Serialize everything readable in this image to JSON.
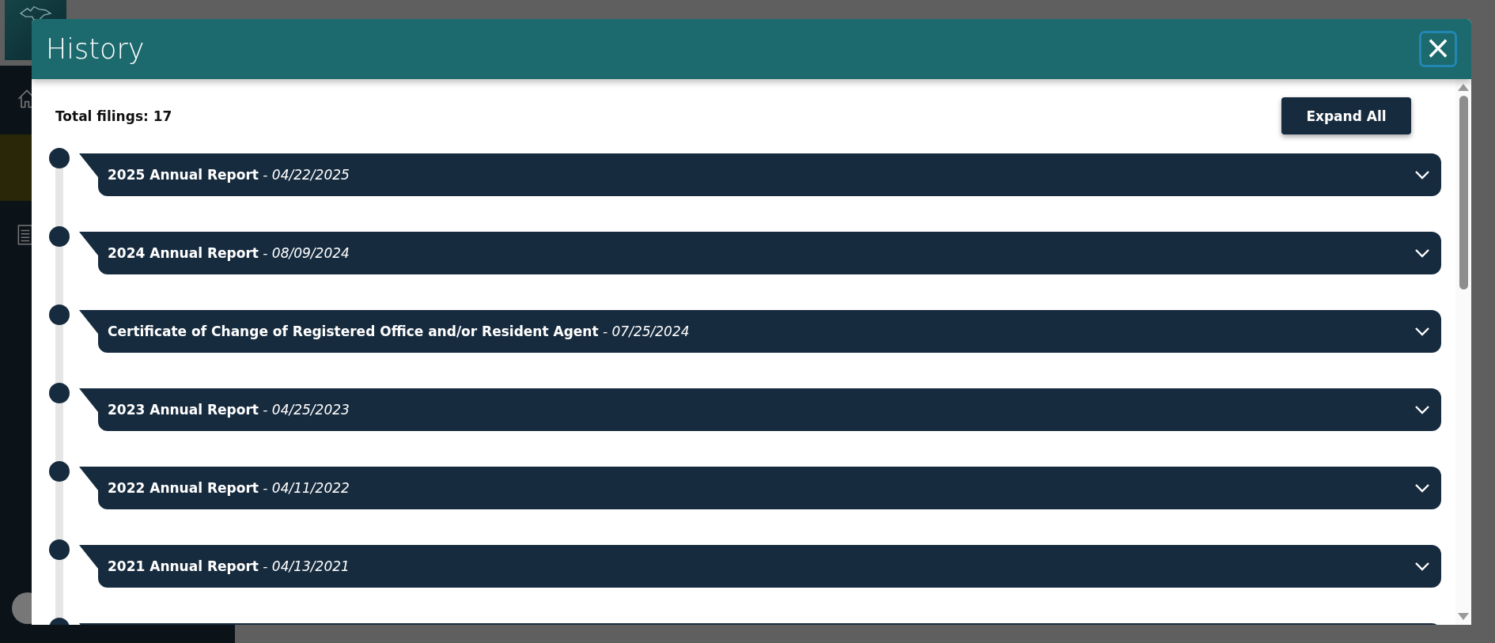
{
  "dialog": {
    "title": "History",
    "close_label": "×"
  },
  "total_filings": "Total filings: 17",
  "expand_all": "Expand All",
  "filings": [
    {
      "name": "2025 Annual Report",
      "date": "- 04/22/2025",
      "expanded": false
    },
    {
      "name": "2024 Annual Report",
      "date": "- 08/09/2024",
      "expanded": false
    },
    {
      "name": "Certificate of Change of Registered Office and/or Resident Agent",
      "date": "- 07/25/2024",
      "expanded": false
    },
    {
      "name": "2023 Annual Report",
      "date": "- 04/25/2023",
      "expanded": false
    },
    {
      "name": "2022 Annual Report",
      "date": "- 04/11/2022",
      "expanded": false
    },
    {
      "name": "2021 Annual Report",
      "date": "- 04/13/2021",
      "expanded": false
    }
  ]
}
